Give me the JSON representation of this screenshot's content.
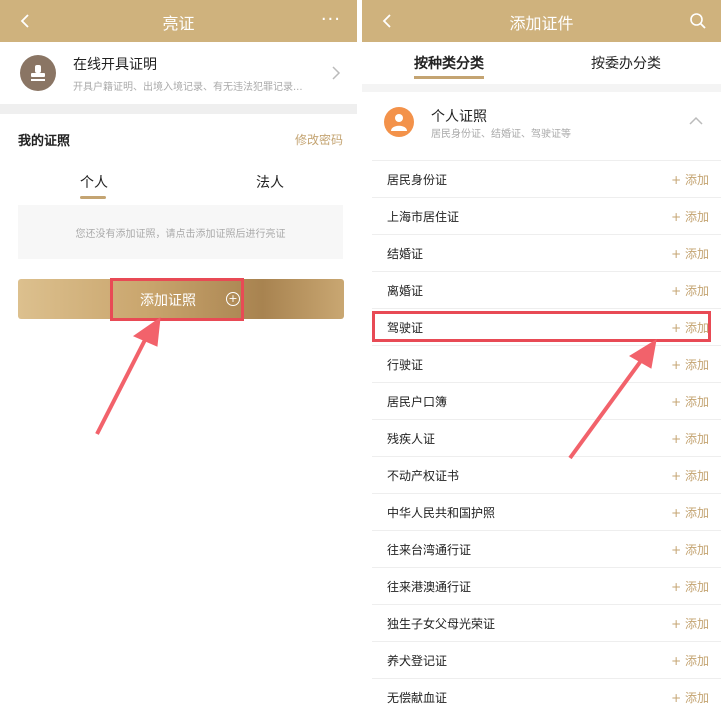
{
  "left_screen": {
    "header": {
      "title": "亮证",
      "more": "···"
    },
    "online_cert": {
      "title": "在线开具证明",
      "subtitle": "开具户籍证明、出境入境记录、有无违法犯罪记录..."
    },
    "my_certs_label": "我的证照",
    "change_password": "修改密码",
    "tabs": [
      "个人",
      "法人"
    ],
    "empty_message": "您还没有添加证照，请点击添加证照后进行亮证",
    "add_button_label": "添加证照",
    "add_button_plus": "+"
  },
  "right_screen": {
    "header": {
      "title": "添加证件"
    },
    "tabs": [
      "按种类分类",
      "按委办分类"
    ],
    "section": {
      "title": "个人证照",
      "subtitle": "居民身份证、结婚证、驾驶证等"
    },
    "add_label": "+ 添加",
    "items": [
      "居民身份证",
      "上海市居住证",
      "结婚证",
      "离婚证",
      "驾驶证",
      "行驶证",
      "居民户口簿",
      "残疾人证",
      "不动产权证书",
      "中华人民共和国护照",
      "往来台湾通行证",
      "往来港澳通行证",
      "独生子女父母光荣证",
      "养犬登记证",
      "无偿献血证"
    ]
  },
  "colors": {
    "header_bg": "#cfb27d",
    "accent": "#c4a472",
    "highlight": "#e84a55"
  }
}
